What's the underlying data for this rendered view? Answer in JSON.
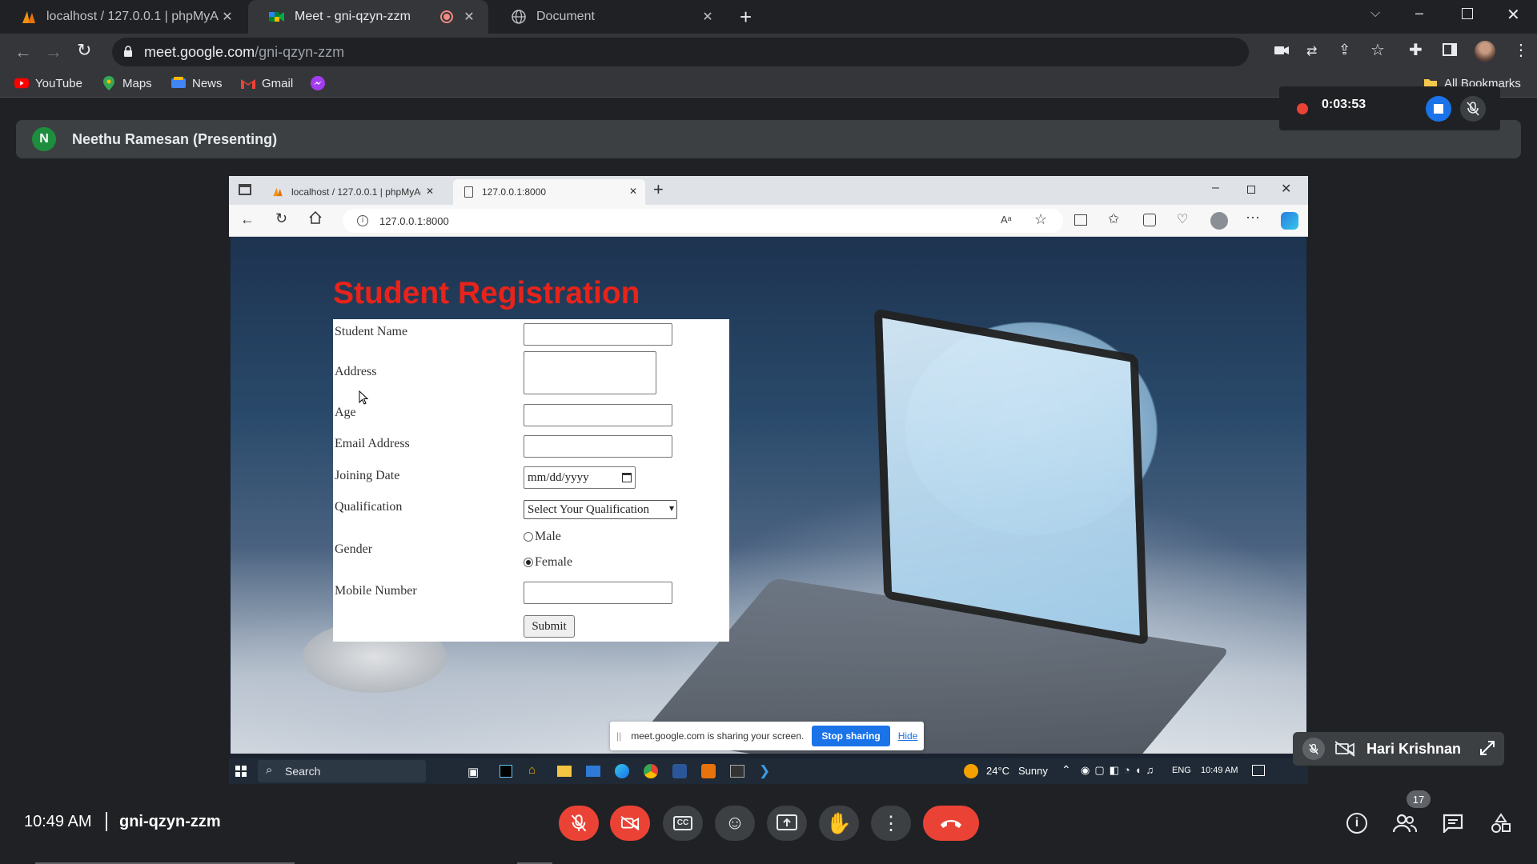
{
  "chrome": {
    "tabs": [
      {
        "title": "localhost / 127.0.0.1 | phpMyAdr",
        "active": false
      },
      {
        "title": "Meet - gni-qzyn-zzm",
        "active": true
      },
      {
        "title": "Document",
        "active": false
      }
    ],
    "url_host": "meet.google.com",
    "url_path": "/gni-qzyn-zzm",
    "bookmarks": [
      "YouTube",
      "Maps",
      "News",
      "Gmail"
    ],
    "all_bookmarks_label": "All Bookmarks"
  },
  "meet": {
    "presenter_initial": "N",
    "presenter_label": "Neethu Ramesan (Presenting)",
    "recording_time": "0:03:53",
    "time": "10:49 AM",
    "meeting_code": "gni-qzyn-zzm",
    "participant_count": "17",
    "self_tile_name": "Hari Krishnan",
    "accent_red": "#ea4335",
    "accent_blue": "#1a73e8"
  },
  "shared_screen": {
    "browser_tabs": [
      {
        "title": "localhost / 127.0.0.1 | phpMyAdr",
        "active": false
      },
      {
        "title": "127.0.0.1:8000",
        "active": true
      }
    ],
    "address": "127.0.0.1:8000",
    "page_title": "Student Registration",
    "form": {
      "student_name_label": "Student Name",
      "address_label": "Address",
      "age_label": "Age",
      "email_label": "Email Address",
      "joining_date_label": "Joining Date",
      "joining_date_placeholder": "mm/dd/yyyy",
      "qualification_label": "Qualification",
      "qualification_selected": "Select Your Qualification",
      "gender_label": "Gender",
      "gender_options": [
        "Male",
        "Female"
      ],
      "gender_selected": "Female",
      "mobile_label": "Mobile Number",
      "submit_label": "Submit"
    },
    "share_notice": {
      "text": "meet.google.com is sharing your screen.",
      "stop_label": "Stop sharing",
      "hide_label": "Hide"
    },
    "taskbar": {
      "search_label": "Search",
      "weather_temp": "24°C",
      "weather_desc": "Sunny",
      "language": "ENG",
      "clock": "10:49 AM"
    }
  }
}
